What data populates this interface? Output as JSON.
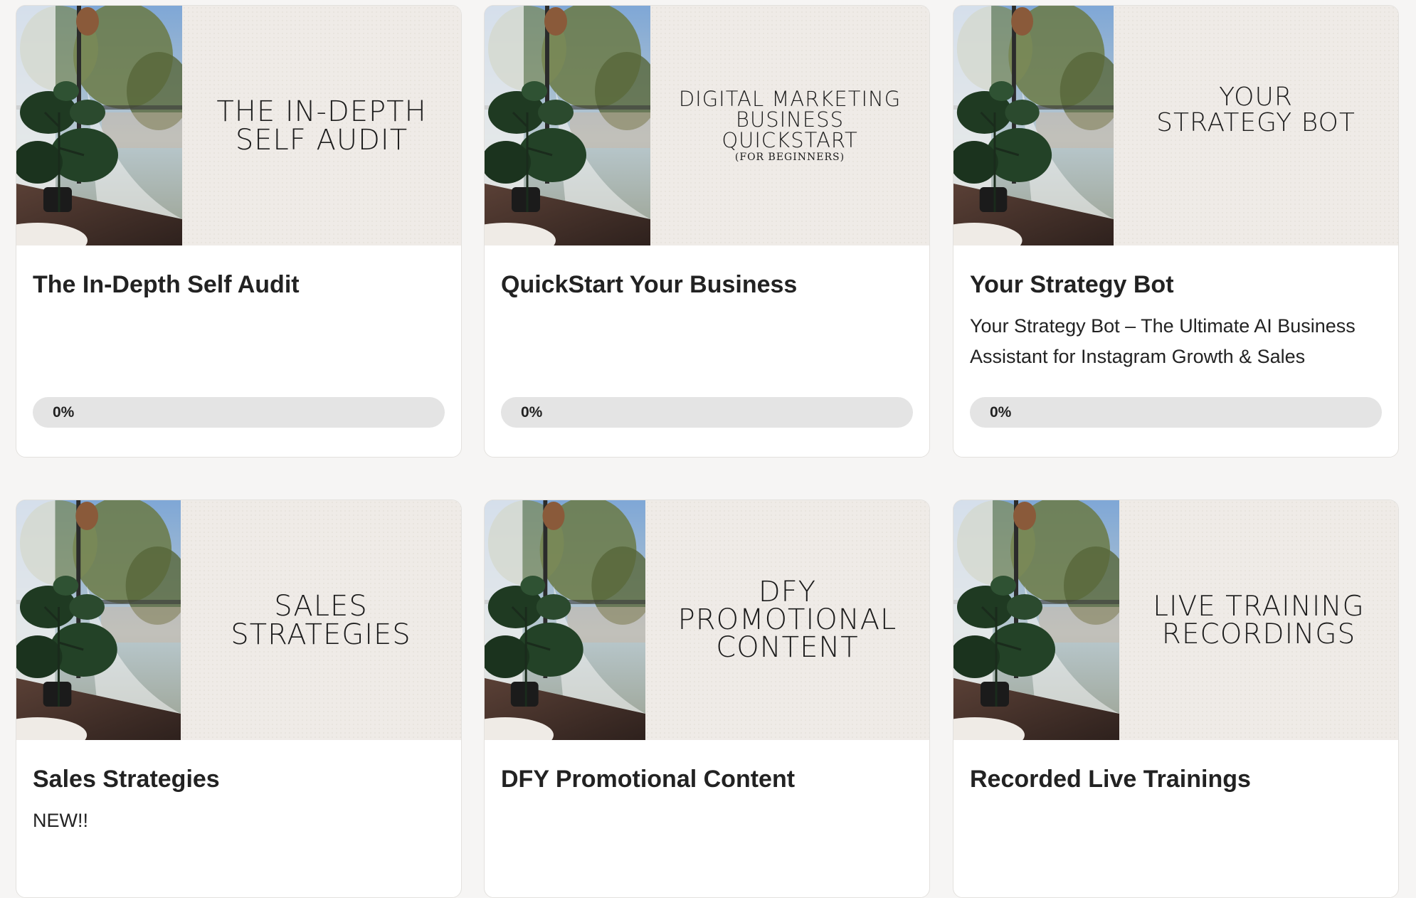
{
  "courses": [
    {
      "banner_lines": "THE IN-DEPTH\nSELF AUDIT",
      "banner_sub": "",
      "title": "The In-Depth Self Audit",
      "description": "",
      "progress_label": "0%",
      "progress_fraction": 0
    },
    {
      "banner_lines": "DIGITAL MARKETING\nBUSINESS\nQUICKSTART",
      "banner_sub": "(FOR BEGINNERS)",
      "title": "QuickStart Your Business",
      "description": "",
      "progress_label": "0%",
      "progress_fraction": 0
    },
    {
      "banner_lines": "YOUR\nSTRATEGY BOT",
      "banner_sub": "",
      "title": "Your Strategy Bot",
      "description": "Your Strategy Bot – The Ultimate AI Business Assistant for Instagram Growth & Sales",
      "progress_label": "0%",
      "progress_fraction": 0
    },
    {
      "banner_lines": "SALES\nSTRATEGIES",
      "banner_sub": "",
      "title": "Sales Strategies",
      "description": "NEW!!",
      "progress_label": "",
      "progress_fraction": null
    },
    {
      "banner_lines": "DFY\nPROMOTIONAL\nCONTENT",
      "banner_sub": "",
      "title": "DFY Promotional Content",
      "description": "",
      "progress_label": "",
      "progress_fraction": null
    },
    {
      "banner_lines": "LIVE TRAINING\nRECORDINGS",
      "banner_sub": "",
      "title": "Recorded Live Trainings",
      "description": "",
      "progress_label": "",
      "progress_fraction": null
    }
  ],
  "colors": {
    "page_bg": "#f6f5f4",
    "card_bg": "#ffffff",
    "banner_bg": "#efebe7",
    "progress_track": "#e4e4e4",
    "text": "#222222"
  }
}
